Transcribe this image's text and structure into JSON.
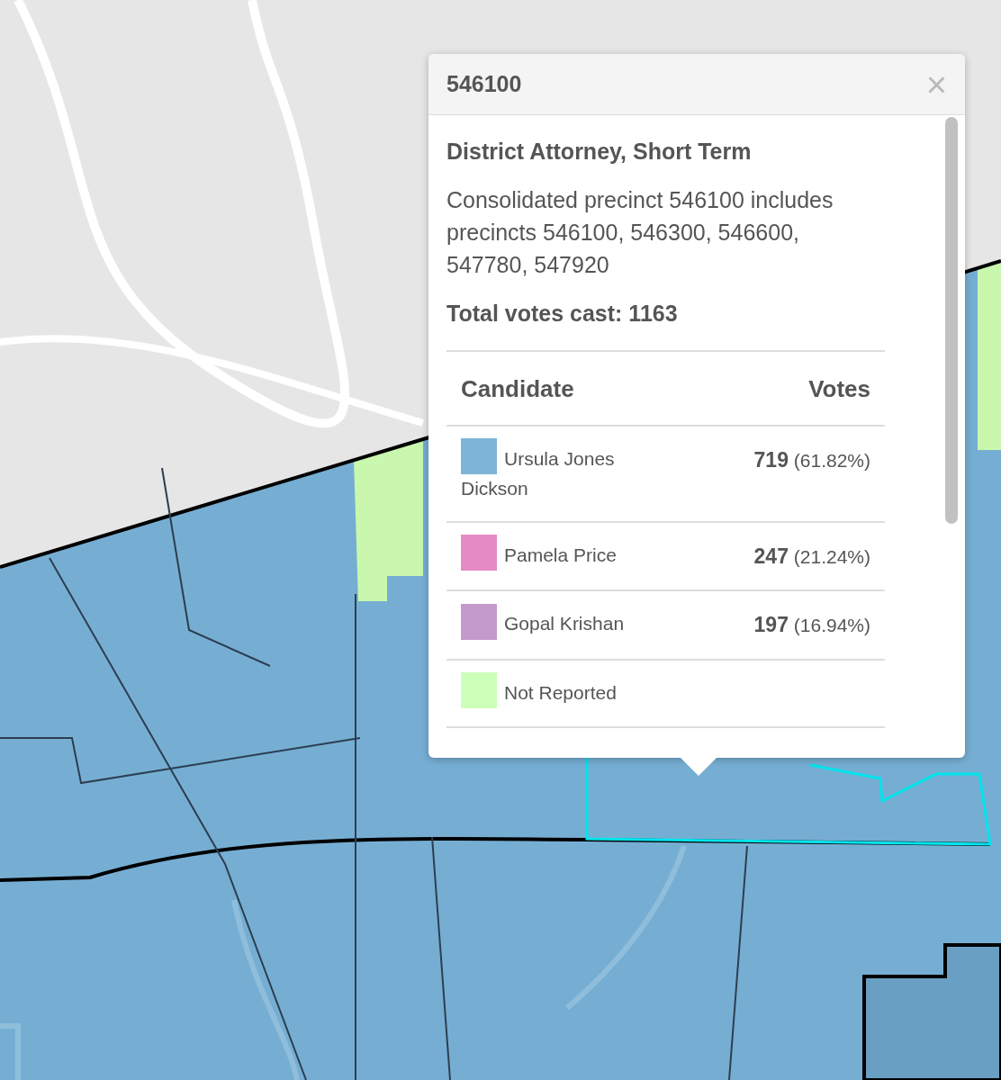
{
  "popup": {
    "title": "546100",
    "close": "×",
    "contest": "District Attorney, Short Term",
    "description": "Consolidated precinct 546100 includes precincts 546100, 546300, 546600, 547780, 547920",
    "total": "Total votes cast: 1163",
    "table": {
      "columns": [
        "Candidate",
        "Votes"
      ],
      "rows": [
        {
          "name": "Ursula Jones Dickson",
          "color": "#7db4d8",
          "votes": "719",
          "percent": "(61.82%)"
        },
        {
          "name": "Pamela Price",
          "color": "#e68ac6",
          "votes": "247",
          "percent": "(21.24%)"
        },
        {
          "name": "Gopal Krishan",
          "color": "#c39acb",
          "votes": "197",
          "percent": "(16.94%)"
        },
        {
          "name": "Not Reported",
          "color": "#ccffb8"
        }
      ]
    }
  }
}
